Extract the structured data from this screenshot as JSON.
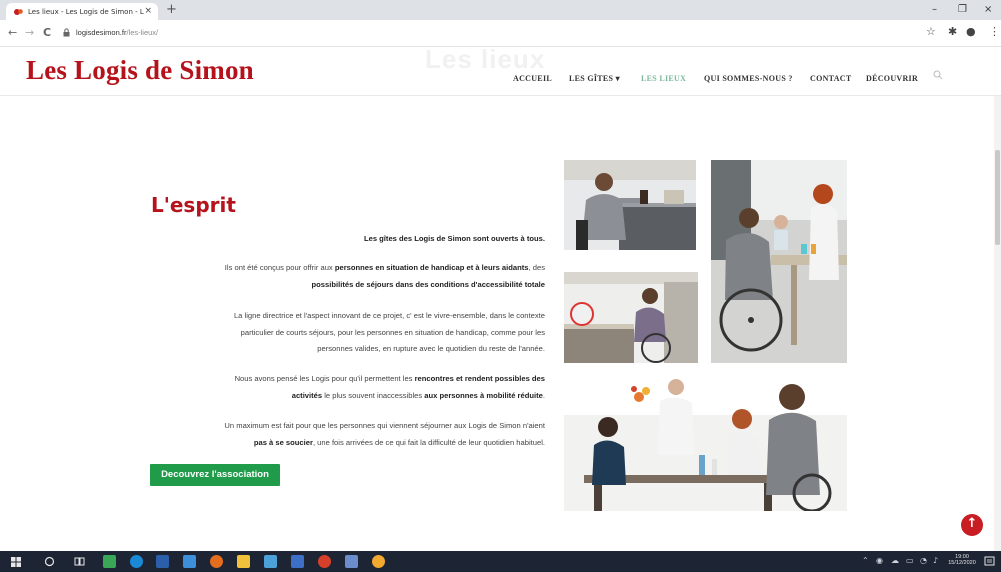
{
  "browser": {
    "tab_title": "Les lieux - Les Logis de Simon - L",
    "tab_close": "×",
    "new_tab": "+",
    "url_host": "logisdesimon.fr",
    "url_path": "/les-lieux/",
    "nav_back": "←",
    "nav_forward": "→",
    "nav_reload": "C",
    "win_minimize": "–",
    "win_restore": "❐",
    "win_close": "×",
    "star": "☆",
    "extensions": "✱",
    "profile": "●",
    "menu": "⋮"
  },
  "site": {
    "logo": "Les Logis de Simon",
    "page_title_ghost": "Les lieux",
    "brand_color": "#b5121b",
    "nav": [
      {
        "label": "ACCUEIL",
        "active": false
      },
      {
        "label": "LES GÎTES",
        "active": false
      },
      {
        "label": "LES LIEUX",
        "active": true
      },
      {
        "label": "QUI SOMMES-NOUS ?",
        "active": false
      },
      {
        "label": "CONTACT",
        "active": false
      },
      {
        "label": "DÉCOUVRIR",
        "active": false
      }
    ],
    "nav_dropdown": "▾"
  },
  "content": {
    "heading": "L'esprit",
    "p1": "Les gîtes des Logis de Simon sont ouverts à tous.",
    "p2_a": "Ils ont été conçus pour offrir aux ",
    "p2_b": "personnes en situation de handicap et à leurs aidants",
    "p2_c": ", des",
    "p2_d": "possibilités de séjours dans des conditions d'accessibilité totale",
    "p3_l1": "La ligne directrice et l'aspect innovant de ce projet, c' est le vivre-ensemble, dans le contexte",
    "p3_l2": "particulier de courts séjours,  pour les personnes en situation de handicap, comme pour les",
    "p3_l3": "personnes valides, en rupture avec le quotidien du reste de l'année.",
    "p4_a": "Nous avons pensé les Logis pour qu'il permettent les ",
    "p4_b": "rencontres et rendent possibles des",
    "p4_c": "activités",
    "p4_d": " le plus souvent  inaccessibles ",
    "p4_e": "aux personnes à mobilité réduite",
    "p4_f": ".",
    "p5_a": "Un maximum est fait pour que les personnes qui viennent séjourner aux Logis de Simon n'aient",
    "p5_b": "pas à se soucier",
    "p5_c": ", une fois arrivées de ce qui fait la difficulté de leur quotidien habituel.",
    "cta": "Decouvrez l'association",
    "cta_color": "#1f9b4a",
    "scroll_top": "↑"
  },
  "taskbar": {
    "time": "19:00",
    "date": "15/12/2020"
  }
}
